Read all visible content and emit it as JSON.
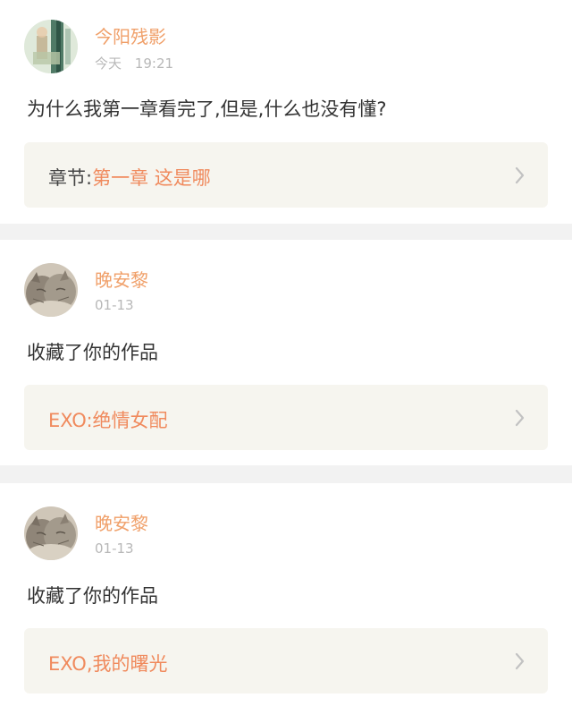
{
  "notifications": [
    {
      "user": "今阳残影",
      "date": "今天",
      "time": "19:21",
      "message": "为什么我第一章看完了,但是,什么也没有懂?",
      "card": {
        "prefix": "章节:",
        "title": "第一章 这是哪"
      }
    },
    {
      "user": "晚安黎",
      "date": "01-13",
      "message": "收藏了你的作品",
      "card": {
        "title": "EXO:绝情女配"
      }
    },
    {
      "user": "晚安黎",
      "date": "01-13",
      "message": "收藏了你的作品",
      "card": {
        "title": "EXO,我的曙光"
      }
    }
  ],
  "colors": {
    "accent": "#f08a5d",
    "username": "#f0a06a",
    "muted": "#b8b8b8",
    "card_bg": "#f6f5ef",
    "separator": "#f2f2f2"
  },
  "icons": {
    "chevron": "chevron-right-icon",
    "avatar1": "avatar-image",
    "avatar2": "avatar-cat-image"
  }
}
